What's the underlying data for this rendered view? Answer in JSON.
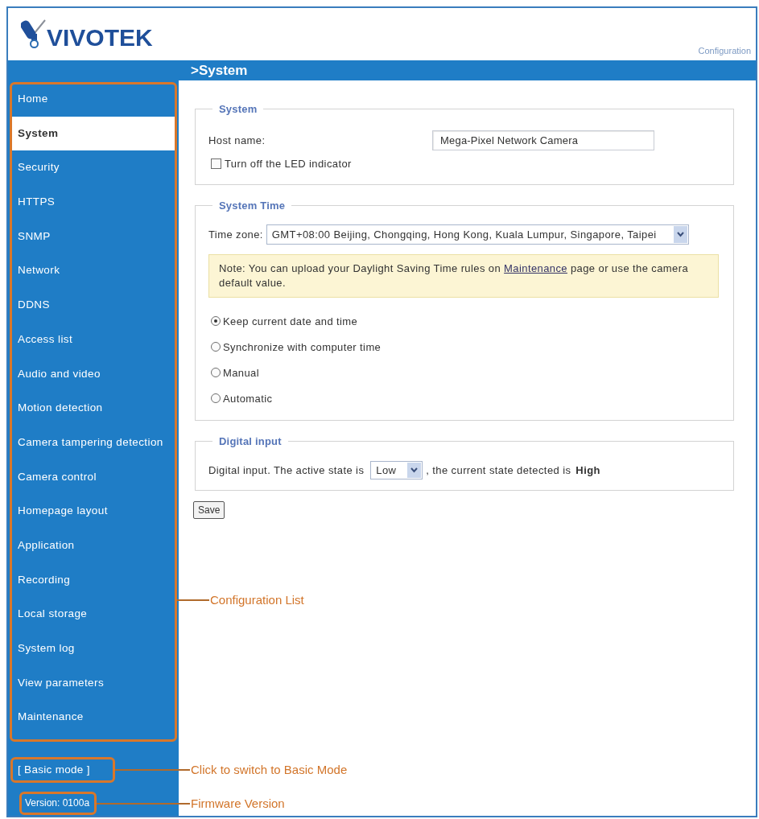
{
  "header": {
    "logo_text": "VIVOTEK",
    "nav_link": "Configuration"
  },
  "title_bar": {
    "title": ">System"
  },
  "sidebar": {
    "items": [
      {
        "label": "Home",
        "selected": false
      },
      {
        "label": "System",
        "selected": true
      },
      {
        "label": "Security",
        "selected": false
      },
      {
        "label": "HTTPS",
        "selected": false
      },
      {
        "label": "SNMP",
        "selected": false
      },
      {
        "label": "Network",
        "selected": false
      },
      {
        "label": "DDNS",
        "selected": false
      },
      {
        "label": "Access list",
        "selected": false
      },
      {
        "label": "Audio and video",
        "selected": false
      },
      {
        "label": "Motion detection",
        "selected": false
      },
      {
        "label": "Camera tampering detection",
        "selected": false
      },
      {
        "label": "Camera control",
        "selected": false
      },
      {
        "label": "Homepage layout",
        "selected": false
      },
      {
        "label": "Application",
        "selected": false
      },
      {
        "label": "Recording",
        "selected": false
      },
      {
        "label": "Local storage",
        "selected": false
      },
      {
        "label": "System log",
        "selected": false
      },
      {
        "label": "View parameters",
        "selected": false
      },
      {
        "label": "Maintenance",
        "selected": false
      }
    ],
    "basic_mode_link": "[ Basic mode ]",
    "version": "Version: 0100a"
  },
  "sections": [
    {
      "legend": "System",
      "fields": [
        {
          "kind": "text",
          "label": "Host name:",
          "value": "Mega-Pixel Network Camera"
        },
        {
          "kind": "checkbox",
          "label": "Turn off the LED indicator",
          "checked": false
        }
      ]
    },
    {
      "legend": "System Time",
      "fields": [
        {
          "kind": "select",
          "label": "Time zone:",
          "value": "GMT+08:00 Beijing, Chongqing, Hong Kong, Kuala Lumpur, Singapore, Taipei"
        },
        {
          "kind": "note",
          "text": "Note: You can upload your Daylight Saving Time rules on ",
          "link": "Maintenance",
          "text_after": " page or use the camera default value."
        },
        {
          "kind": "radio",
          "label": "Keep current date and time",
          "selected": true
        },
        {
          "kind": "radio",
          "label": "Synchronize with computer time",
          "selected": false
        },
        {
          "kind": "radio",
          "label": "Manual",
          "selected": false
        },
        {
          "kind": "radio",
          "label": "Automatic",
          "selected": false
        }
      ]
    },
    {
      "legend": "Digital input",
      "fields": [
        {
          "kind": "state_sentence",
          "text_before": "Digital input. The active state is",
          "value": "Low",
          "text_after": ", the current state detected is",
          "state": "High"
        }
      ]
    }
  ],
  "save_button": "Save",
  "annotations": [
    {
      "kind": "menu",
      "label": "Configuration List"
    },
    {
      "kind": "basic_mode",
      "label": "Click to switch to Basic Mode"
    },
    {
      "kind": "version",
      "label": "Firmware Version"
    }
  ]
}
